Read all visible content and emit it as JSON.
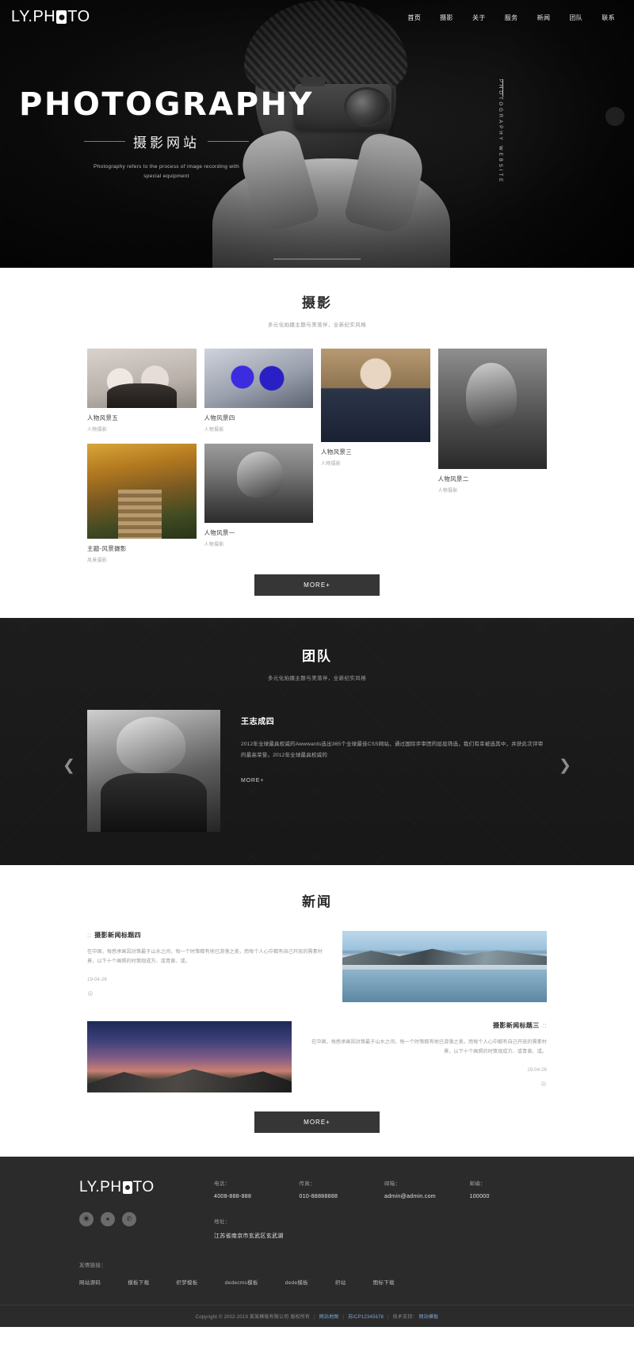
{
  "brand": {
    "name_left": "LY.PH",
    "name_right": "TO",
    "mark_icon": "camera-mark-icon"
  },
  "nav": {
    "items": [
      {
        "label": "首页",
        "active": true
      },
      {
        "label": "摄影",
        "active": false
      },
      {
        "label": "关于",
        "active": false
      },
      {
        "label": "服务",
        "active": false
      },
      {
        "label": "新闻",
        "active": false
      },
      {
        "label": "团队",
        "active": false
      },
      {
        "label": "联系",
        "active": false
      }
    ]
  },
  "hero": {
    "title": "PHOTOGRAPHY",
    "subtitle": "摄影网站",
    "description": "Photography refers to the process of image recording with special equipment",
    "vertical_label": "PHOTOGRAPHY WEBSITE"
  },
  "portfolio": {
    "title": "摄影",
    "subtitle": "多元化拍摄主题与美落伴，全新纪实风格",
    "items": [
      {
        "caption": "人物风景五",
        "category": "人物摄影",
        "thumb": "t-kids"
      },
      {
        "caption": "人物风景四",
        "category": "人物摄影",
        "thumb": "t-blue"
      },
      {
        "caption": "人物风景三",
        "category": "人物摄影",
        "thumb": "t-boy"
      },
      {
        "caption": "人物风景二",
        "category": "人物摄影",
        "thumb": "t-girlbw"
      },
      {
        "caption": "主题-风景摄影",
        "category": "风景摄影",
        "thumb": "t-autumn"
      },
      {
        "caption": "人物风景一",
        "category": "人物摄影",
        "thumb": "t-girl2"
      }
    ],
    "more_label": "MORE+"
  },
  "team": {
    "title": "团队",
    "subtitle": "多元化拍摄主题与美落伴，全新纪实风格",
    "member": {
      "name": "王志成四",
      "bio": "2012年全球最具权威的Awwwards选出365个全球最佳CSS网站，通过国际评审团的层层筛选，我们有幸被选其中，并获此次评审的最高荣誉。2012年全球最具权威的",
      "more_label": "MORE+"
    },
    "prev_icon": "chevron-left-icon",
    "next_icon": "chevron-right-icon"
  },
  "news": {
    "title": "新闻",
    "items": [
      {
        "marker": "::",
        "title": "摄影新闻标题四",
        "summary": "在中国，每感承画因对策最于山水之间，每一个时策都有地已游落之美，而每个人心中都有自己开放的需素村景，以下十个画照的时策观成方、或青黄、或。",
        "date": "19-04-26",
        "plus": "⊕",
        "pic": "pic-lake",
        "align": "left"
      },
      {
        "marker": "::",
        "title": "摄影新闻标题三",
        "summary": "在中国，每感承画因对策最于山水之间，每一个时策都有地已游落之美，而每个人心中都有自己开放的需素村景，以下十个画照的时策观成方、或青黄、或。",
        "date": "19-04-26",
        "plus": "⊕",
        "pic": "pic-night",
        "align": "right"
      }
    ],
    "more_label": "MORE+"
  },
  "footer": {
    "contact": [
      {
        "label": "电话：",
        "value": "4008-888-888"
      },
      {
        "label": "传真：",
        "value": "010-88888888"
      },
      {
        "label": "邮箱：",
        "value": "admin@admin.com"
      },
      {
        "label": "邮编：",
        "value": "100000"
      }
    ],
    "address": {
      "label": "地址：",
      "value": "江苏省南京市玄武区玄武湖"
    },
    "links": {
      "label": "友情链接：",
      "items": [
        "网站源码",
        "模板下载",
        "织梦模板",
        "dedecms模板",
        "dede模板",
        "织站",
        "图标下载"
      ]
    },
    "social": [
      {
        "icon": "weibo-icon",
        "glyph": "◉"
      },
      {
        "icon": "wechat-icon",
        "glyph": "●"
      },
      {
        "icon": "qq-icon",
        "glyph": "✆"
      }
    ],
    "copyright_prefix": "Copyright © 2002-2019 某某模板有限公司 版权所有",
    "copyright_link1": "网站地图",
    "copyright_icp": "苏ICP12345678",
    "copyright_mid": "技术支持：",
    "copyright_link2": "网站模板"
  }
}
